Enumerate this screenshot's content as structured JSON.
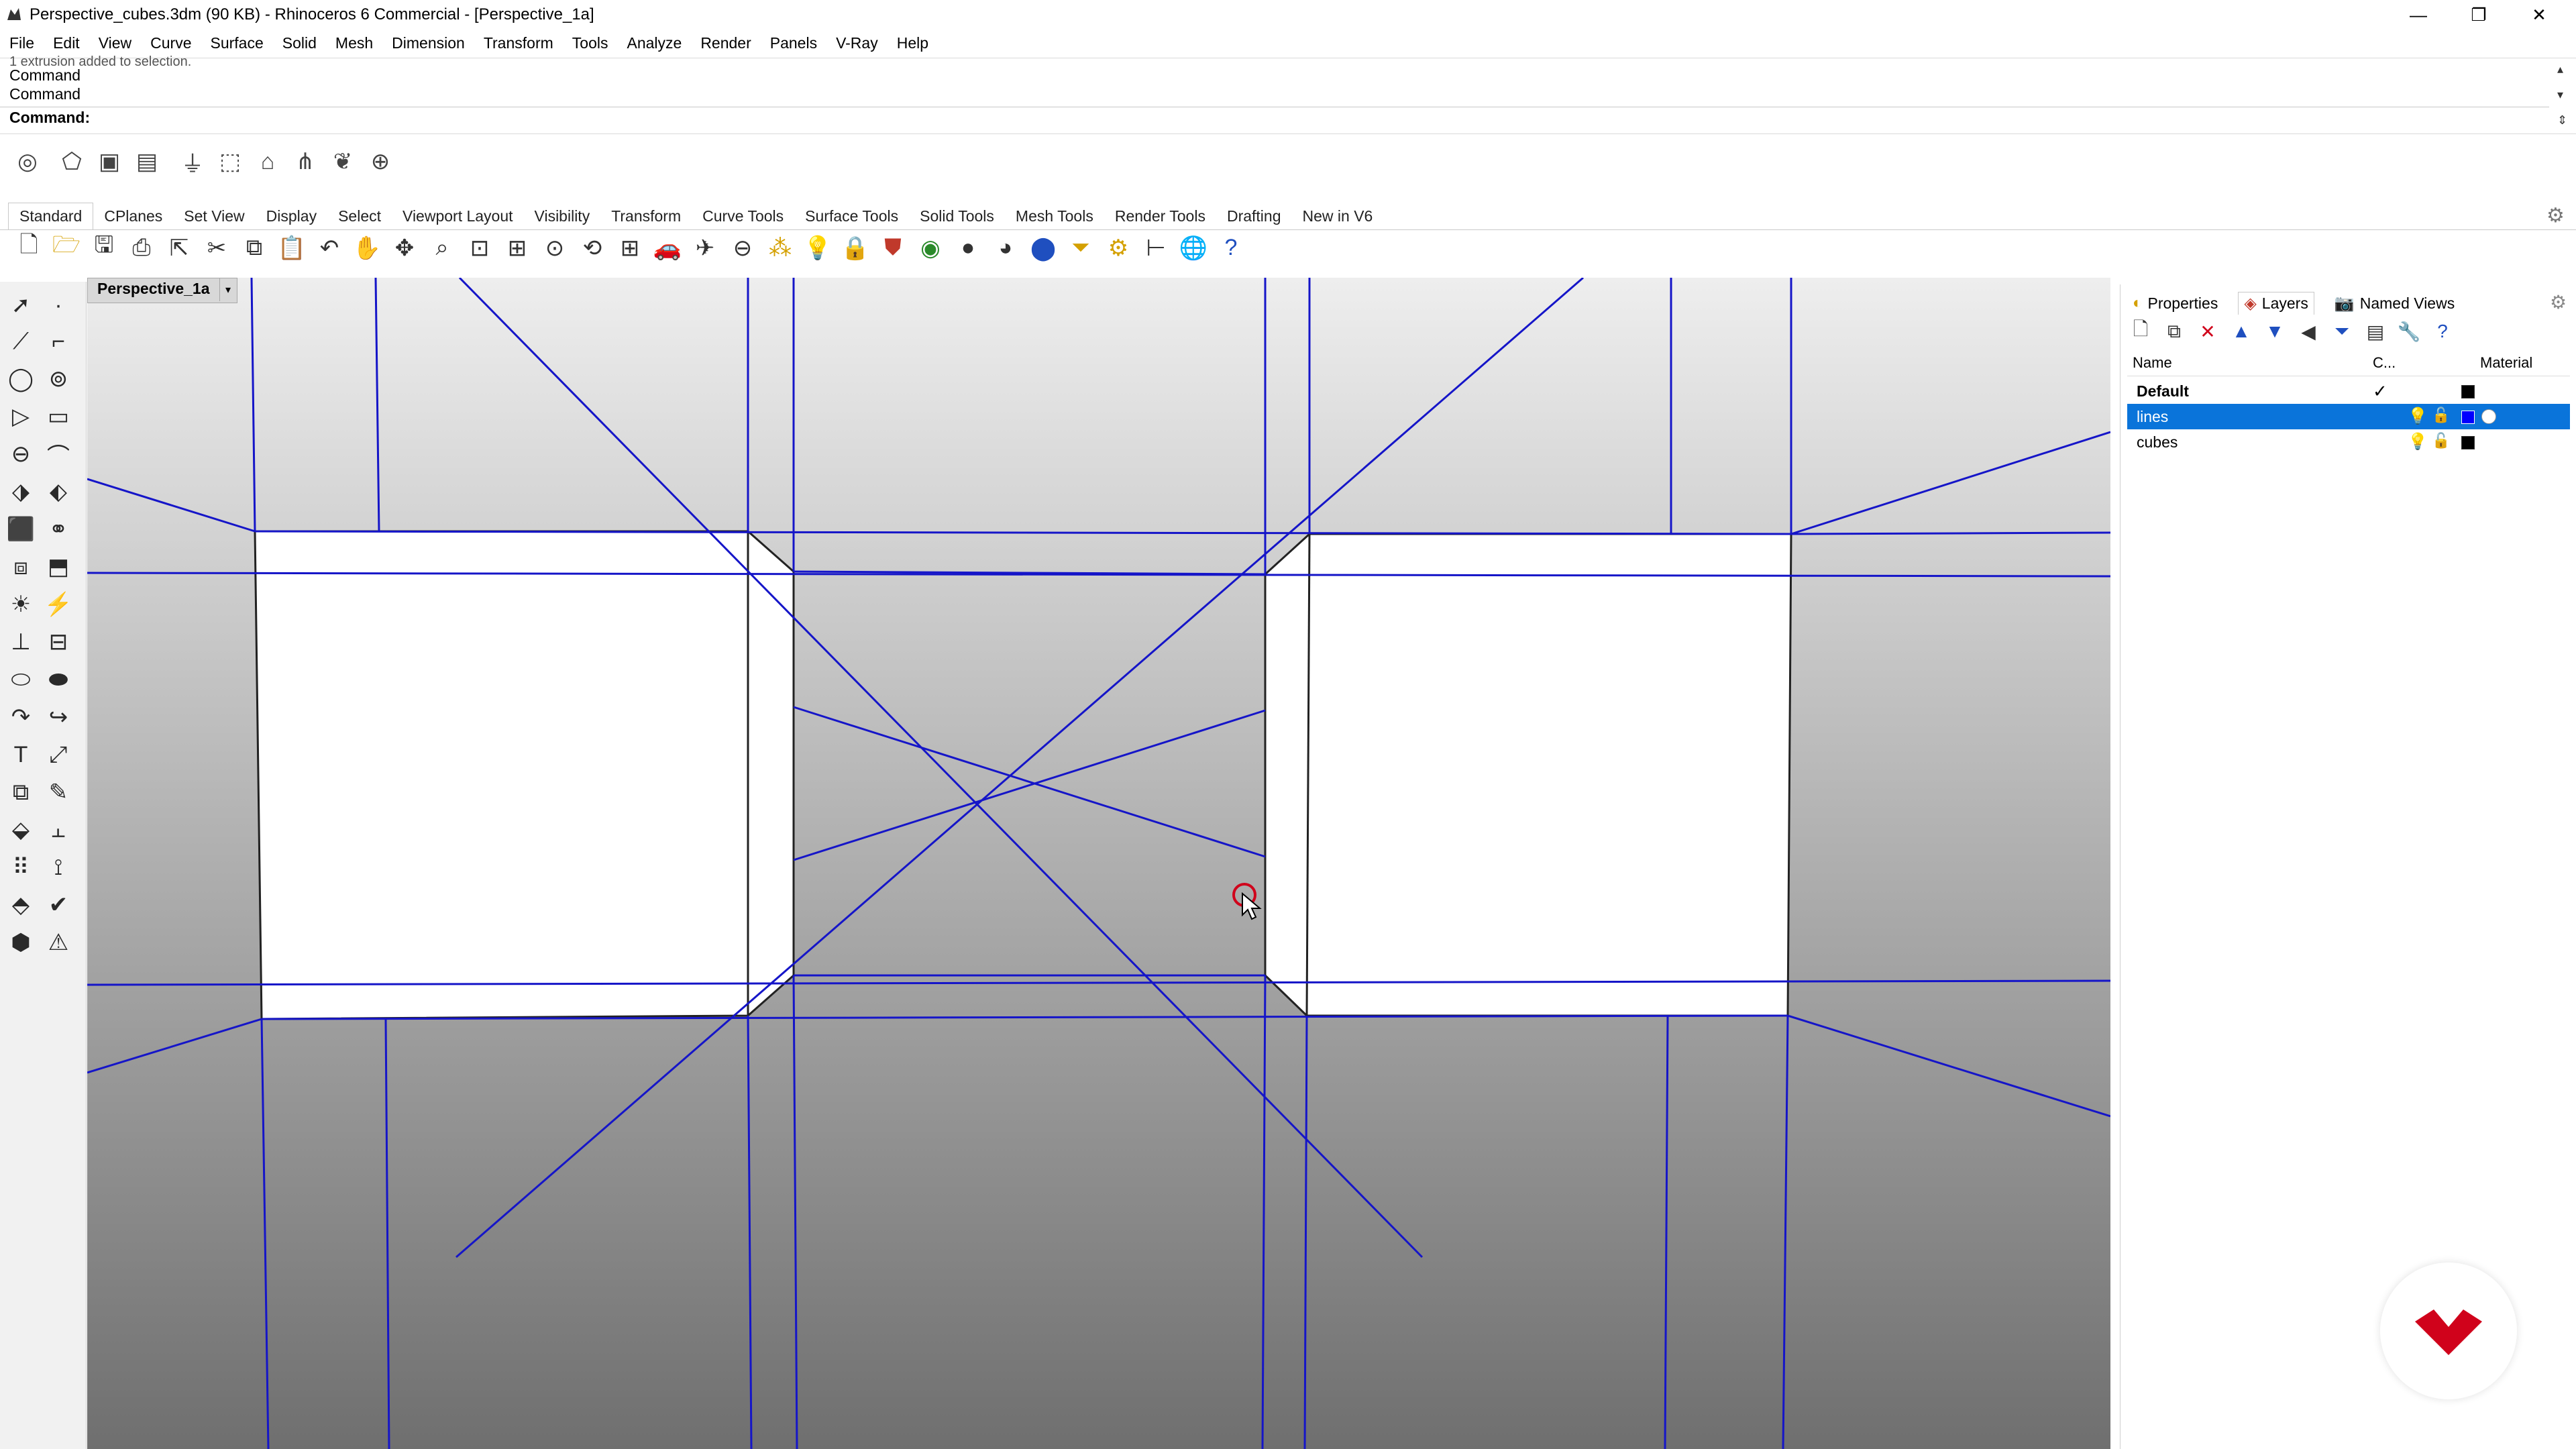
{
  "window": {
    "title": "Perspective_cubes.3dm (90 KB) - Rhinoceros 6 Commercial - [Perspective_1a]",
    "controls": {
      "minimize": "—",
      "maximize": "❐",
      "close": "✕"
    }
  },
  "menu": [
    "File",
    "Edit",
    "View",
    "Curve",
    "Surface",
    "Solid",
    "Mesh",
    "Dimension",
    "Transform",
    "Tools",
    "Analyze",
    "Render",
    "Panels",
    "V-Ray",
    "Help"
  ],
  "command": {
    "previous_partial": "1 extrusion added to selection.",
    "history": [
      "Command",
      "Command"
    ],
    "prompt_label": "Command:",
    "input_value": ""
  },
  "tabs": [
    "Standard",
    "CPlanes",
    "Set View",
    "Display",
    "Select",
    "Viewport Layout",
    "Visibility",
    "Transform",
    "Curve Tools",
    "Surface Tools",
    "Solid Tools",
    "Mesh Tools",
    "Render Tools",
    "Drafting",
    "New in V6"
  ],
  "active_tab": "Standard",
  "viewport": {
    "name": "Perspective_1a",
    "dropdown": "▾",
    "line_color": "#1515c8",
    "bg_top": "#eeeeee",
    "bg_bottom": "#6f6f6f"
  },
  "panel": {
    "tabs": [
      {
        "label": "Properties",
        "icon": "properties-icon"
      },
      {
        "label": "Layers",
        "icon": "layers-icon"
      },
      {
        "label": "Named Views",
        "icon": "camera-icon"
      }
    ],
    "active_tab": "Layers",
    "columns": {
      "name": "Name",
      "current": "C...",
      "material": "Material"
    },
    "layers": [
      {
        "name": "Default",
        "current": "✓",
        "color": "#000000",
        "selected": false
      },
      {
        "name": "lines",
        "current": "",
        "color": "#0000ff",
        "selected": true
      },
      {
        "name": "cubes",
        "current": "",
        "color": "#000000",
        "selected": false
      }
    ]
  },
  "colors": {
    "selection": "#0a74da",
    "logo_red": "#d0021b"
  }
}
